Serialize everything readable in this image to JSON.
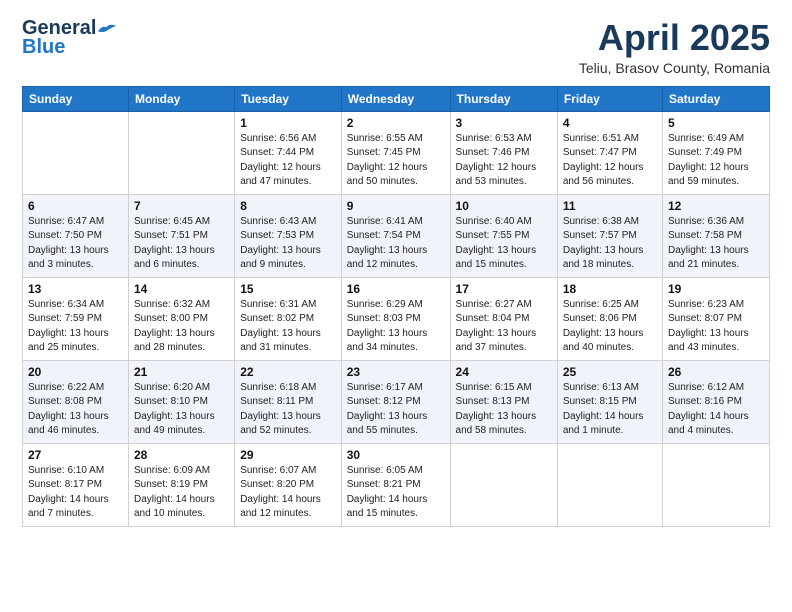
{
  "header": {
    "logo_general": "General",
    "logo_blue": "Blue",
    "title": "April 2025",
    "location": "Teliu, Brasov County, Romania"
  },
  "weekdays": [
    "Sunday",
    "Monday",
    "Tuesday",
    "Wednesday",
    "Thursday",
    "Friday",
    "Saturday"
  ],
  "weeks": [
    [
      {
        "day": "",
        "info": ""
      },
      {
        "day": "",
        "info": ""
      },
      {
        "day": "1",
        "info": "Sunrise: 6:56 AM\nSunset: 7:44 PM\nDaylight: 12 hours and 47 minutes."
      },
      {
        "day": "2",
        "info": "Sunrise: 6:55 AM\nSunset: 7:45 PM\nDaylight: 12 hours and 50 minutes."
      },
      {
        "day": "3",
        "info": "Sunrise: 6:53 AM\nSunset: 7:46 PM\nDaylight: 12 hours and 53 minutes."
      },
      {
        "day": "4",
        "info": "Sunrise: 6:51 AM\nSunset: 7:47 PM\nDaylight: 12 hours and 56 minutes."
      },
      {
        "day": "5",
        "info": "Sunrise: 6:49 AM\nSunset: 7:49 PM\nDaylight: 12 hours and 59 minutes."
      }
    ],
    [
      {
        "day": "6",
        "info": "Sunrise: 6:47 AM\nSunset: 7:50 PM\nDaylight: 13 hours and 3 minutes."
      },
      {
        "day": "7",
        "info": "Sunrise: 6:45 AM\nSunset: 7:51 PM\nDaylight: 13 hours and 6 minutes."
      },
      {
        "day": "8",
        "info": "Sunrise: 6:43 AM\nSunset: 7:53 PM\nDaylight: 13 hours and 9 minutes."
      },
      {
        "day": "9",
        "info": "Sunrise: 6:41 AM\nSunset: 7:54 PM\nDaylight: 13 hours and 12 minutes."
      },
      {
        "day": "10",
        "info": "Sunrise: 6:40 AM\nSunset: 7:55 PM\nDaylight: 13 hours and 15 minutes."
      },
      {
        "day": "11",
        "info": "Sunrise: 6:38 AM\nSunset: 7:57 PM\nDaylight: 13 hours and 18 minutes."
      },
      {
        "day": "12",
        "info": "Sunrise: 6:36 AM\nSunset: 7:58 PM\nDaylight: 13 hours and 21 minutes."
      }
    ],
    [
      {
        "day": "13",
        "info": "Sunrise: 6:34 AM\nSunset: 7:59 PM\nDaylight: 13 hours and 25 minutes."
      },
      {
        "day": "14",
        "info": "Sunrise: 6:32 AM\nSunset: 8:00 PM\nDaylight: 13 hours and 28 minutes."
      },
      {
        "day": "15",
        "info": "Sunrise: 6:31 AM\nSunset: 8:02 PM\nDaylight: 13 hours and 31 minutes."
      },
      {
        "day": "16",
        "info": "Sunrise: 6:29 AM\nSunset: 8:03 PM\nDaylight: 13 hours and 34 minutes."
      },
      {
        "day": "17",
        "info": "Sunrise: 6:27 AM\nSunset: 8:04 PM\nDaylight: 13 hours and 37 minutes."
      },
      {
        "day": "18",
        "info": "Sunrise: 6:25 AM\nSunset: 8:06 PM\nDaylight: 13 hours and 40 minutes."
      },
      {
        "day": "19",
        "info": "Sunrise: 6:23 AM\nSunset: 8:07 PM\nDaylight: 13 hours and 43 minutes."
      }
    ],
    [
      {
        "day": "20",
        "info": "Sunrise: 6:22 AM\nSunset: 8:08 PM\nDaylight: 13 hours and 46 minutes."
      },
      {
        "day": "21",
        "info": "Sunrise: 6:20 AM\nSunset: 8:10 PM\nDaylight: 13 hours and 49 minutes."
      },
      {
        "day": "22",
        "info": "Sunrise: 6:18 AM\nSunset: 8:11 PM\nDaylight: 13 hours and 52 minutes."
      },
      {
        "day": "23",
        "info": "Sunrise: 6:17 AM\nSunset: 8:12 PM\nDaylight: 13 hours and 55 minutes."
      },
      {
        "day": "24",
        "info": "Sunrise: 6:15 AM\nSunset: 8:13 PM\nDaylight: 13 hours and 58 minutes."
      },
      {
        "day": "25",
        "info": "Sunrise: 6:13 AM\nSunset: 8:15 PM\nDaylight: 14 hours and 1 minute."
      },
      {
        "day": "26",
        "info": "Sunrise: 6:12 AM\nSunset: 8:16 PM\nDaylight: 14 hours and 4 minutes."
      }
    ],
    [
      {
        "day": "27",
        "info": "Sunrise: 6:10 AM\nSunset: 8:17 PM\nDaylight: 14 hours and 7 minutes."
      },
      {
        "day": "28",
        "info": "Sunrise: 6:09 AM\nSunset: 8:19 PM\nDaylight: 14 hours and 10 minutes."
      },
      {
        "day": "29",
        "info": "Sunrise: 6:07 AM\nSunset: 8:20 PM\nDaylight: 14 hours and 12 minutes."
      },
      {
        "day": "30",
        "info": "Sunrise: 6:05 AM\nSunset: 8:21 PM\nDaylight: 14 hours and 15 minutes."
      },
      {
        "day": "",
        "info": ""
      },
      {
        "day": "",
        "info": ""
      },
      {
        "day": "",
        "info": ""
      }
    ]
  ]
}
